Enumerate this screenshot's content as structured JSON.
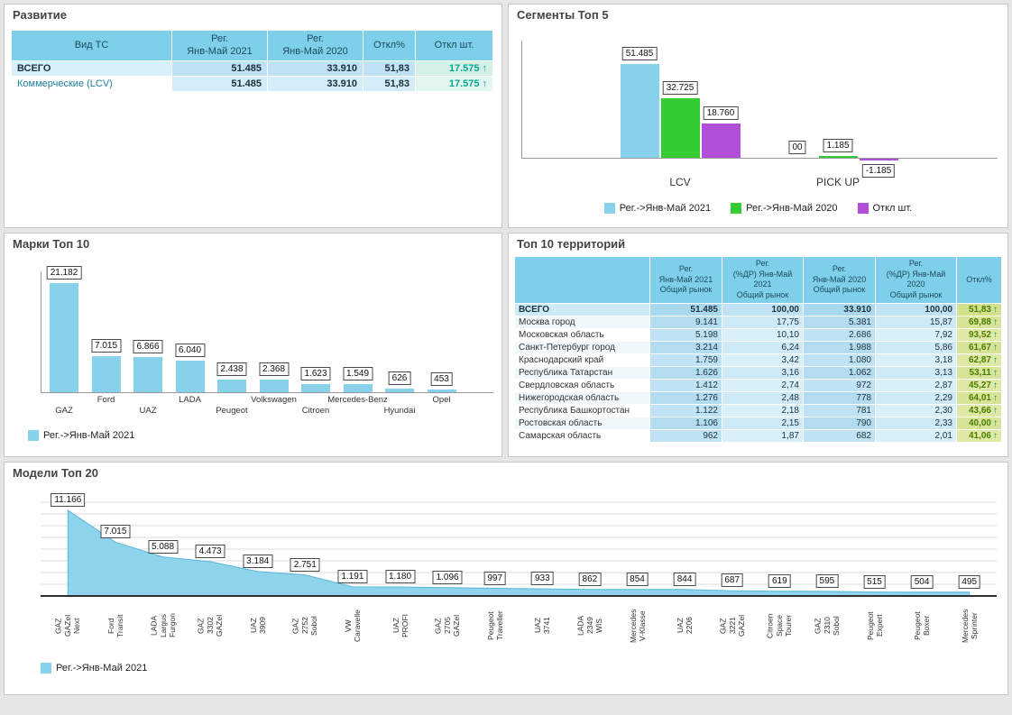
{
  "dashboard": {
    "bg": "#e6e6e6",
    "accent_blue": "#87d1ea",
    "accent_green": "#33cc33",
    "accent_purple": "#b24fd8",
    "positive_teal": "#00a693",
    "header_blue": "#7ed0ea"
  },
  "chart_data": [
    {
      "type": "table",
      "title": "Развитие",
      "columns": [
        "Вид ТС",
        "Рег.\nЯнв-Май 2021",
        "Рег.\nЯнв-Май 2020",
        "Откл%",
        "Откл шт."
      ],
      "rows": [
        {
          "label": "ВСЕГО",
          "v2021": "51.485",
          "v2020": "33.910",
          "otkl_pct": "51,83",
          "otkl_sht": "17.575",
          "trend": "up",
          "total": true
        },
        {
          "label": "Коммерческие (LCV)",
          "v2021": "51.485",
          "v2020": "33.910",
          "otkl_pct": "51,83",
          "otkl_sht": "17.575",
          "trend": "up",
          "total": false
        }
      ]
    },
    {
      "type": "bar",
      "title": "Сегменты Топ 5",
      "categories": [
        "LCV",
        "PICK UP"
      ],
      "series": [
        {
          "name": "Рег.->Янв-Май 2021",
          "color": "#87d1ea",
          "values": [
            51485,
            0
          ],
          "labels": [
            "51.485",
            "00"
          ]
        },
        {
          "name": "Рег.->Янв-Май 2020",
          "color": "#33cc33",
          "values": [
            32725,
            1185
          ],
          "labels": [
            "32.725",
            "1.185"
          ]
        },
        {
          "name": "Откл шт.",
          "color": "#b24fd8",
          "values": [
            18760,
            -1185
          ],
          "labels": [
            "18.760",
            "-1.185"
          ]
        }
      ],
      "ylim": [
        -1185,
        51485
      ],
      "grid": false,
      "legend_position": "bottom"
    },
    {
      "type": "bar",
      "title": "Марки Топ 10",
      "categories": [
        "GAZ",
        "Ford",
        "UAZ",
        "LADA",
        "Peugeot",
        "Volkswagen",
        "Citroen",
        "Mercedes-Benz",
        "Hyundai",
        "Opel"
      ],
      "values": [
        21182,
        7015,
        6866,
        6040,
        2438,
        2368,
        1623,
        1549,
        626,
        453
      ],
      "labels": [
        "21.182",
        "7.015",
        "6.866",
        "6.040",
        "2.438",
        "2.368",
        "1.623",
        "1.549",
        "626",
        "453"
      ],
      "series_color": "#87d1ea",
      "legend": [
        {
          "name": "Рег.->Янв-Май 2021",
          "color": "#87d1ea"
        }
      ],
      "ylim": [
        0,
        21182
      ],
      "grid": false,
      "legend_position": "bottom-left"
    },
    {
      "type": "table",
      "title": "Топ 10 территорий",
      "columns": [
        "",
        "Рег.\nЯнв-Май 2021\nОбщий рынок",
        "Рег.\n(%ДР) Янв-Май 2021\nОбщий рынок",
        "Рег.\nЯнв-Май 2020\nОбщий рынок",
        "Рег.\n(%ДР) Янв-Май 2020\nОбщий рынок",
        "Откл%"
      ],
      "rows": [
        {
          "label": "ВСЕГО",
          "values": [
            "51.485",
            "100,00",
            "33.910",
            "100,00"
          ],
          "otkl": "51,83",
          "trend": "up",
          "total": true
        },
        {
          "label": "Москва город",
          "values": [
            "9.141",
            "17,75",
            "5.381",
            "15,87"
          ],
          "otkl": "69,88",
          "trend": "up",
          "total": false
        },
        {
          "label": "Московская область",
          "values": [
            "5.198",
            "10,10",
            "2.686",
            "7,92"
          ],
          "otkl": "93,52",
          "trend": "up",
          "total": false
        },
        {
          "label": "Санкт-Петербург город",
          "values": [
            "3.214",
            "6,24",
            "1.988",
            "5,86"
          ],
          "otkl": "61,67",
          "trend": "up",
          "total": false
        },
        {
          "label": "Краснодарский край",
          "values": [
            "1.759",
            "3,42",
            "1.080",
            "3,18"
          ],
          "otkl": "62,87",
          "trend": "up",
          "total": false
        },
        {
          "label": "Республика Татарстан",
          "values": [
            "1.626",
            "3,16",
            "1.062",
            "3,13"
          ],
          "otkl": "53,11",
          "trend": "up",
          "total": false
        },
        {
          "label": "Свердловская область",
          "values": [
            "1.412",
            "2,74",
            "972",
            "2,87"
          ],
          "otkl": "45,27",
          "trend": "up",
          "total": false
        },
        {
          "label": "Нижегородская область",
          "values": [
            "1.276",
            "2,48",
            "778",
            "2,29"
          ],
          "otkl": "64,01",
          "trend": "up",
          "total": false
        },
        {
          "label": "Республика Башкортостан",
          "values": [
            "1.122",
            "2,18",
            "781",
            "2,30"
          ],
          "otkl": "43,66",
          "trend": "up",
          "total": false
        },
        {
          "label": "Ростовская область",
          "values": [
            "1.106",
            "2,15",
            "790",
            "2,33"
          ],
          "otkl": "40,00",
          "trend": "up",
          "total": false
        },
        {
          "label": "Самарская область",
          "values": [
            "962",
            "1,87",
            "682",
            "2,01"
          ],
          "otkl": "41,06",
          "trend": "up",
          "total": false
        }
      ]
    },
    {
      "type": "area",
      "title": "Модели Топ 20",
      "categories": [
        "GAZ\nGAZel\nNext",
        "Ford\nTransit",
        "LADA\nLargus\nFurgon",
        "GAZ\n3302\nGAZel",
        "UAZ\n3909",
        "GAZ\n2752\nSobol",
        "VW\nCaravelle",
        "UAZ\nPROFI",
        "GAZ\n2705\nGAZel",
        "Peugeot\nTraveller",
        "UAZ\n3741",
        "LADA\n2349\nWIS",
        "Mercedes\nV-Klasse",
        "UAZ\n2206",
        "GAZ\n3221\nGAZel",
        "Citroen\nSpace\nTourer",
        "GAZ\n2310\nSobol",
        "Peugeot\nExpert",
        "Peugeot\nBoxer",
        "Mercedes\nSprinter"
      ],
      "values": [
        11166,
        7015,
        5088,
        4473,
        3184,
        2751,
        1191,
        1180,
        1096,
        997,
        933,
        862,
        854,
        844,
        687,
        619,
        595,
        515,
        504,
        495
      ],
      "labels": [
        "11.166",
        "7.015",
        "5.088",
        "4.473",
        "3.184",
        "2.751",
        "1.191",
        "1.180",
        "1.096",
        "997",
        "933",
        "862",
        "854",
        "844",
        "687",
        "619",
        "595",
        "515",
        "504",
        "495"
      ],
      "series_color": "#87d1ea",
      "legend": [
        {
          "name": "Рег.->Янв-Май 2021",
          "color": "#87d1ea"
        }
      ],
      "ylim": [
        0,
        11166
      ],
      "grid": true,
      "legend_position": "bottom-left"
    }
  ]
}
